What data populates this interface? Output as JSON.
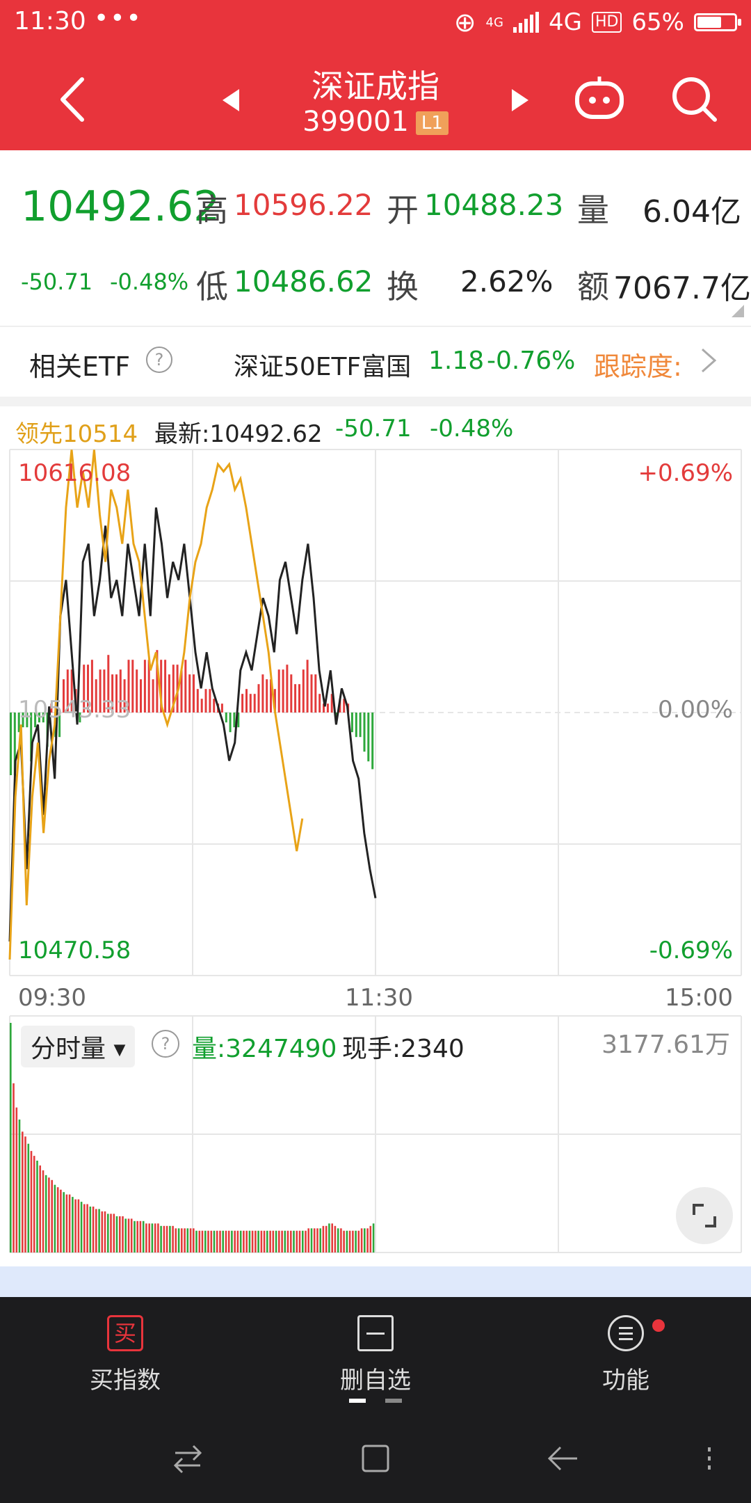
{
  "status": {
    "time": "11:30",
    "dots": "•••",
    "network": "4G",
    "network_small": "4G",
    "hd": "HD",
    "battery": "65%",
    "battery_level": 0.65
  },
  "header": {
    "title": "深证成指",
    "code": "399001",
    "badge": "L1"
  },
  "quote": {
    "price": "10492.62",
    "change": "-50.71",
    "change_pct": "-0.48%",
    "high_label": "高",
    "high": "10596.22",
    "low_label": "低",
    "low": "10486.62",
    "open_label": "开",
    "open": "10488.23",
    "turnover_label": "换",
    "turnover": "2.62%",
    "volume_label": "量",
    "volume": "6.04亿",
    "amount_label": "额",
    "amount": "7067.7亿"
  },
  "etf": {
    "label": "相关ETF",
    "name": "深证50ETF富国",
    "price": "1.18",
    "pct": "-0.76%",
    "track_label": "跟踪度:"
  },
  "chart_data": {
    "type": "line",
    "legend": {
      "lead": "领先10514",
      "latest": "最新:10492.62",
      "change": "-50.71",
      "pct": "-0.48%"
    },
    "y_top": "10616.08",
    "y_bottom": "10470.58",
    "y_mid": "10543.33",
    "pct_top": "+0.69%",
    "pct_mid": "0.00%",
    "pct_bottom": "-0.69%",
    "x_labels": [
      "09:30",
      "11:30",
      "15:00"
    ],
    "ylim": [
      10470.58,
      10616.08
    ],
    "grid": true,
    "series": [
      {
        "color": "#222222",
        "values": [
          10480,
          10530,
          10535,
          10500,
          10535,
          10540,
          10515,
          10545,
          10525,
          10570,
          10580,
          10560,
          10540,
          10585,
          10590,
          10570,
          10580,
          10595,
          10575,
          10580,
          10570,
          10590,
          10580,
          10570,
          10590,
          10570,
          10600,
          10590,
          10575,
          10585,
          10580,
          10590,
          10575,
          10560,
          10550,
          10560,
          10550,
          10545,
          10540,
          10530,
          10535,
          10555,
          10560,
          10555,
          10565,
          10575,
          10570,
          10560,
          10580,
          10585,
          10575,
          10565,
          10580,
          10590,
          10575,
          10555,
          10545,
          10555,
          10540,
          10550,
          10545,
          10530,
          10525,
          10510,
          10500,
          10492
        ]
      },
      {
        "color": "#e8a317",
        "values": [
          10475,
          10520,
          10540,
          10490,
          10520,
          10535,
          10510,
          10530,
          10540,
          10570,
          10600,
          10616,
          10600,
          10610,
          10600,
          10616,
          10598,
          10585,
          10605,
          10600,
          10590,
          10605,
          10590,
          10585,
          10570,
          10555,
          10560,
          10545,
          10540,
          10545,
          10550,
          10560,
          10575,
          10585,
          10590,
          10600,
          10605,
          10612,
          10610,
          10612,
          10605,
          10608,
          10600,
          10590,
          10580,
          10570,
          10560,
          10545,
          10535,
          10525,
          10515,
          10505,
          10514
        ]
      }
    ]
  },
  "volume": {
    "selector": "分时量",
    "volume_text": "量:3247490",
    "current_text": "现手:2340",
    "amount_text": "3177.61万",
    "bars": [
      95,
      70,
      60,
      55,
      50,
      48,
      45,
      42,
      40,
      38,
      36,
      34,
      32,
      31,
      30,
      28,
      27,
      26,
      25,
      24,
      24,
      23,
      22,
      22,
      21,
      20,
      20,
      19,
      19,
      18,
      18,
      17,
      17,
      16,
      16,
      16,
      15,
      15,
      15,
      14,
      14,
      14,
      13,
      13,
      13,
      13,
      12,
      12,
      12,
      12,
      12,
      11,
      11,
      11,
      11,
      11,
      10,
      10,
      10,
      10,
      10,
      10,
      10,
      9,
      9,
      9,
      9,
      9,
      9,
      9,
      9,
      9,
      9,
      9,
      9,
      9,
      9,
      9,
      9,
      9,
      9,
      9,
      9,
      9,
      9,
      9,
      9,
      9,
      9,
      9,
      9,
      9,
      9,
      9,
      9,
      9,
      9,
      9,
      9,
      9,
      9,
      10,
      10,
      10,
      10,
      10,
      11,
      11,
      12,
      12,
      11,
      10,
      10,
      9,
      9,
      9,
      9,
      9,
      9,
      10,
      10,
      10,
      11,
      12
    ]
  },
  "nav": {
    "buy_label": "买指数",
    "buy_icon_text": "买",
    "remove_label": "删自选",
    "func_label": "功能"
  }
}
